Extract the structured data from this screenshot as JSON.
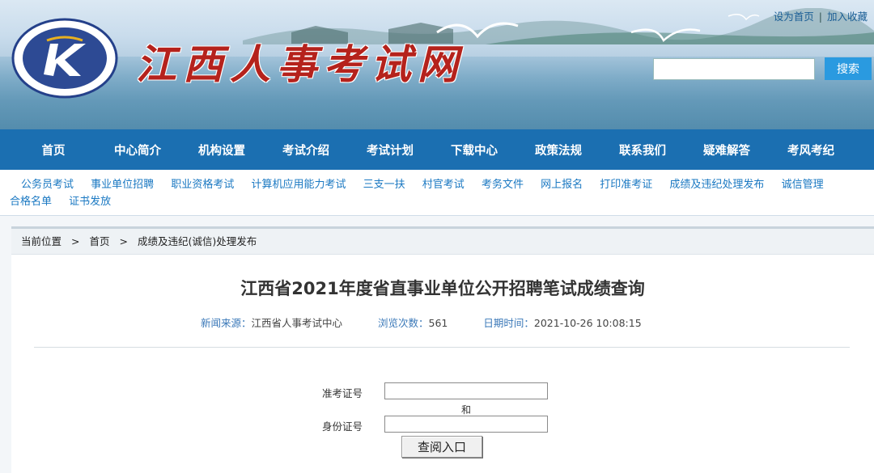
{
  "header": {
    "site_title": "江西人事考试网",
    "set_home": "设为首页",
    "separator": "|",
    "add_favorite": "加入收藏",
    "search_button": "搜索",
    "search_value": "",
    "logo_icon": "jiangxi-exam-emblem"
  },
  "main_nav": {
    "items": [
      "首页",
      "中心简介",
      "机构设置",
      "考试介绍",
      "考试计划",
      "下载中心",
      "政策法规",
      "联系我们",
      "疑难解答",
      "考风考纪"
    ]
  },
  "sub_nav": {
    "items": [
      "公务员考试",
      "事业单位招聘",
      "职业资格考试",
      "计算机应用能力考试",
      "三支一扶",
      "村官考试",
      "考务文件",
      "网上报名",
      "打印准考证",
      "成绩及违纪处理发布",
      "诚信管理",
      "合格名单",
      "证书发放"
    ]
  },
  "breadcrumb": {
    "label": "当前位置",
    "arrow": ">",
    "home": "首页",
    "current": "成绩及违纪(诚信)处理发布"
  },
  "article": {
    "title": "江西省2021年度省直事业单位公开招聘笔试成绩查询",
    "source_label": "新闻来源：",
    "source_value": "江西省人事考试中心",
    "views_label": "浏览次数：",
    "views_value": "561",
    "date_label": "日期时间：",
    "date_value": "2021-10-26 10:08:15"
  },
  "query_form": {
    "ticket_label": "准考证号",
    "ticket_value": "",
    "and_text": "和",
    "id_label": "身份证号",
    "id_value": "",
    "submit_label": "查阅入口"
  },
  "colors": {
    "nav_bg": "#1b6fb1",
    "sub_link": "#1a78c2",
    "title_red": "#b5221c",
    "search_btn": "#2a9ae0"
  }
}
